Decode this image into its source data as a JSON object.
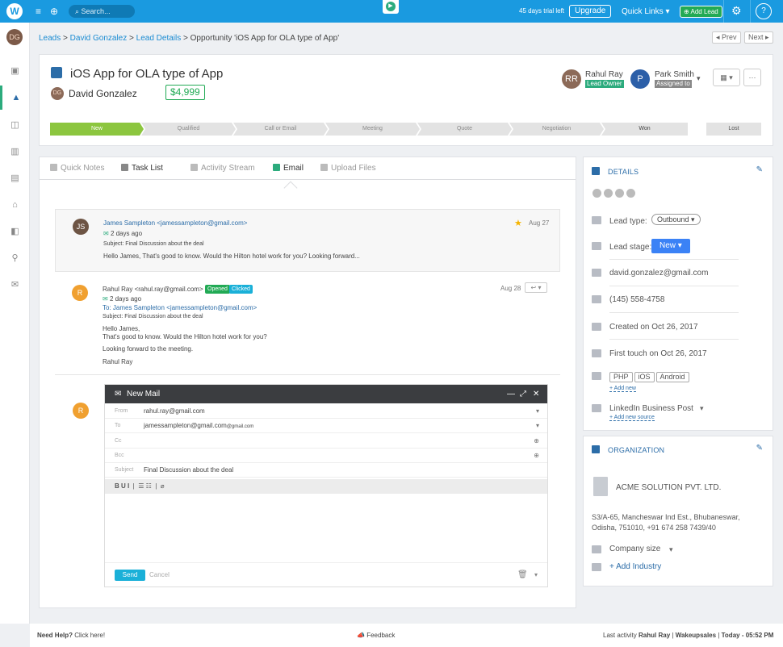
{
  "topbar": {
    "logo": "W",
    "search_placeholder": "Search...",
    "trial": "45 days trial left",
    "upgrade": "Upgrade",
    "quick_links": "Quick Links",
    "add_lead": "Add Lead",
    "help": "?"
  },
  "sidebar": {
    "avatar_initials": "DG"
  },
  "breadcrumb": {
    "leads": "Leads",
    "contact": "David Gonzalez",
    "lead_details": "Lead Details",
    "current": "Opportunity 'iOS App for OLA type of App'"
  },
  "nav": {
    "prev": "Prev",
    "next": "Next"
  },
  "opportunity": {
    "title": "iOS App for OLA type of App",
    "contact": "David Gonzalez",
    "contact_initials": "DG",
    "amount": "$4,999"
  },
  "owners": {
    "owner_name": "Rahul Ray",
    "owner_role": "Lead Owner",
    "owner_initials": "RR",
    "assignee_name": "Park Smith",
    "assignee_role": "Assigned to",
    "assignee_initials": "P"
  },
  "pipeline": {
    "stages": [
      "New",
      "Qualified",
      "Call or Email",
      "Meeting",
      "Quote",
      "Negotiation",
      "Won"
    ],
    "lost": "Lost"
  },
  "tabs": [
    "Quick Notes",
    "Task List",
    "Activity Stream",
    "Email",
    "Upload Files"
  ],
  "emails": [
    {
      "from": "James Sampleton <jamessampleton@gmail.com>",
      "time": "2 days ago",
      "subject": "Subject: Final Discussion about the deal",
      "body": "Hello James, That's good to know. Would the Hilton hotel work for you? Looking forward...",
      "date": "Aug 27",
      "initials": "JS"
    },
    {
      "from": "Rahul Ray <rahul.ray@gmail.com>",
      "badge_opened": "Opened",
      "badge_clicked": "Clicked",
      "time": "2 days ago",
      "to": "To: James Sampleton <jamessampleton@gmail.com>",
      "subject": "Subject: Final Discussion about the deal",
      "body_line1": "Hello James,",
      "body_line2": "That's good to know. Would the Hilton hotel work for you?",
      "body_line3": "Looking forward to the meeting.",
      "signature": "Rahul Ray",
      "date": "Aug 28",
      "initials": "R"
    }
  ],
  "compose": {
    "avatar": "R",
    "title": "New Mail",
    "from_label": "From",
    "from_value": "rahul.ray@gmail.com",
    "to_label": "To",
    "to_value": "jamessampleton@gmail.com",
    "to_value_suffix": "@gmail.com",
    "cc_label": "Cc",
    "bcc_label": "Bcc",
    "subject_label": "Subject",
    "subject_value": "Final Discussion about the deal",
    "toolbar": "B U I",
    "send": "Send",
    "cancel": "Cancel"
  },
  "details": {
    "title": "DETAILS",
    "lead_type_label": "Lead type:",
    "lead_type_value": "Outbound",
    "lead_stage_label": "Lead stage:",
    "lead_stage_value": "New",
    "email": "david.gonzalez@gmail.com",
    "phone": "(145) 558-4758",
    "created": "Created on Oct 26, 2017",
    "first_touch": "First touch on Oct 26, 2017",
    "tags": [
      "PHP",
      "iOS",
      "Android"
    ],
    "add_new": "+ Add new",
    "source": "LinkedIn Business Post",
    "add_source": "+ Add new source"
  },
  "organization": {
    "title": "ORGANIZATION",
    "name": "ACME SOLUTION PVT. LTD.",
    "address_line1": "S3/A-65, Mancheswar Ind Est., Bhubaneswar,",
    "address_line2": "Odisha, 751010, +91 674 258 7439/40",
    "company_size": "Company size",
    "add_industry": "+ Add Industry"
  },
  "footer": {
    "help": "Need Help?",
    "click_here": "Click here!",
    "feedback": "Feedback",
    "last_activity": "Last activity",
    "last_user": "Rahul Ray",
    "company": "Wakeupsales",
    "time": "Today - 05:52 PM"
  },
  "colors": {
    "brand": "#1a9ae0",
    "accent_green": "#2cab7d",
    "stage_current": "#8cc63f",
    "link": "#2c6da8"
  }
}
